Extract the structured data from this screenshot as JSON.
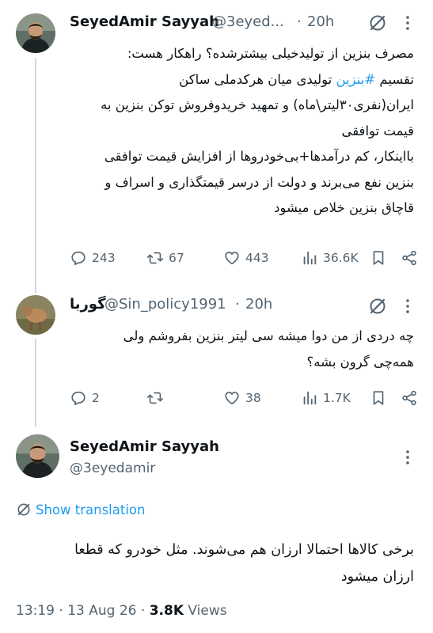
{
  "colors": {
    "text": "#0f1419",
    "muted": "#536471",
    "accent": "#1d9bf0",
    "divider": "#eff3f4"
  },
  "tweet1": {
    "display_name": "SeyedAmir Sayyah",
    "handle": "@3eyed...",
    "separator": "·",
    "time": "20h",
    "lines": [
      "مصرف بنزین از تولیدخیلی بیشترشده؟ راهکار هست:",
      "",
      "ایران(نفری۳۰لیتر\\ماه) و تمهید خریدوفروش توکن بنزین به",
      "قیمت توافقی",
      "بااینکار، کم درآمدها+بی‌خودروها از افزایش قیمت توافقی",
      "بنزین نفع می‌برند و دولت از درسر قیمتگذاری و اسراف و",
      "قاچاق بنزین خلاص میشود"
    ],
    "line2_prefix": "تقسیم ",
    "line2_hashtag": "#بنزین",
    "line2_suffix": " تولیدی میان هرکدملی ساکن",
    "replies": "243",
    "retweets": "67",
    "likes": "443",
    "views": "36.6K",
    "icons": [
      "grok-icon",
      "more-icon",
      "reply-icon",
      "retweet-icon",
      "like-icon",
      "views-icon",
      "bookmark-icon",
      "share-icon"
    ]
  },
  "tweet2": {
    "display_name": "گوربا",
    "handle": "@Sin_policy1991",
    "separator": "·",
    "time": "20h",
    "lines": [
      "چه دردی از من دوا میشه سی لیتر بنزین بفروشم ولی",
      "همه‌چی گرون بشه؟"
    ],
    "replies": "2",
    "retweets": "",
    "likes": "38",
    "views": "1.7K"
  },
  "main_tweet": {
    "display_name": "SeyedAmir Sayyah",
    "handle": "@3eyedamir",
    "show_translation": "Show translation",
    "lines": [
      "برخی کالاها احتمالا ارزان هم می‌شوند. مثل خودرو که قطعا",
      "ارزان میشود"
    ],
    "time": "13:19",
    "date": "13 Aug 26",
    "separator": "·",
    "views_count": "3.8K",
    "views_label": "Views"
  }
}
